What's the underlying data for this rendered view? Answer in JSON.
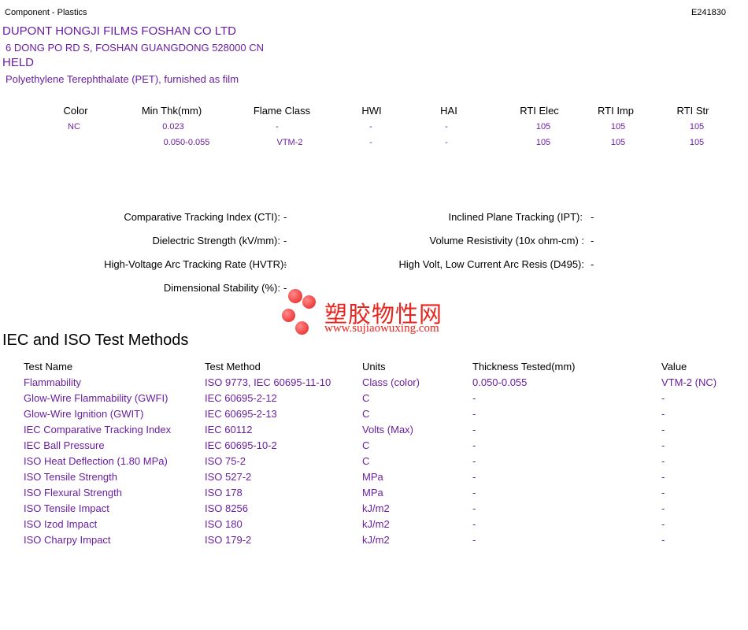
{
  "header": {
    "left_label": "Component - Plastics",
    "file_number": "E241830"
  },
  "company": {
    "name": "DUPONT HONGJI FILMS FOSHAN CO LTD",
    "address": "6 DONG PO RD S, FOSHAN  GUANGDONG  528000 CN",
    "product": "HELD",
    "material": "Polyethylene Terephthalate (PET), furnished as film"
  },
  "ratings": {
    "headers": [
      "Color",
      "Min Thk(mm)",
      "Flame Class",
      "HWI",
      "HAI",
      "RTI Elec",
      "RTI Imp",
      "RTI Str"
    ],
    "rows": [
      [
        "NC",
        "0.023",
        "-",
        "-",
        "-",
        "105",
        "105",
        "105"
      ],
      [
        "",
        "0.050-0.055",
        "VTM-2",
        "-",
        "-",
        "105",
        "105",
        "105"
      ]
    ]
  },
  "properties": {
    "cti_label": "Comparative Tracking Index (CTI):",
    "cti_value": "-",
    "ipt_label": "Inclined Plane Tracking (IPT):",
    "ipt_value": "-",
    "dielectric_label": "Dielectric Strength (kV/mm):",
    "dielectric_value": "-",
    "volume_label": "Volume Resistivity (10x ohm-cm) :",
    "volume_value": "-",
    "hvtr_label": "High-Voltage Arc Tracking Rate (HVTR):",
    "hvtr_value": "-",
    "d495_label": "High Volt, Low Current Arc Resis (D495):",
    "d495_value": "-",
    "dimstab_label": "Dimensional Stability (%):",
    "dimstab_value": "-"
  },
  "watermark": {
    "chinese": "塑胶物性网",
    "url": "www.sujiaowuxing.com",
    "color": "#e8261f"
  },
  "methods": {
    "section_title": "IEC and ISO Test Methods",
    "headers": [
      "Test Name",
      "Test Method",
      "Units",
      "Thickness Tested(mm)",
      "Value"
    ],
    "rows": [
      [
        "Flammability",
        "ISO 9773, IEC 60695-11-10",
        "Class (color)",
        "0.050-0.055",
        "VTM-2 (NC)"
      ],
      [
        "Glow-Wire Flammability (GWFI)",
        "IEC 60695-2-12",
        "C",
        "-",
        "-"
      ],
      [
        "Glow-Wire Ignition (GWIT)",
        "IEC 60695-2-13",
        "C",
        "-",
        "-"
      ],
      [
        "IEC Comparative Tracking Index",
        "IEC 60112",
        "Volts (Max)",
        "-",
        "-"
      ],
      [
        "IEC Ball Pressure",
        "IEC 60695-10-2",
        "C",
        "-",
        "-"
      ],
      [
        "ISO Heat Deflection (1.80 MPa)",
        "ISO 75-2",
        "C",
        "-",
        "-"
      ],
      [
        "ISO Tensile Strength",
        "ISO 527-2",
        "MPa",
        "-",
        "-"
      ],
      [
        "ISO Flexural Strength",
        "ISO 178",
        "MPa",
        "-",
        "-"
      ],
      [
        "ISO Tensile Impact",
        "ISO 8256",
        "kJ/m2",
        "-",
        "-"
      ],
      [
        "ISO Izod Impact",
        "ISO 180",
        "kJ/m2",
        "-",
        "-"
      ],
      [
        "ISO Charpy Impact",
        "ISO 179-2",
        "kJ/m2",
        "-",
        "-"
      ]
    ]
  },
  "colors": {
    "text": "#000000",
    "accent": "#6a1fa0",
    "watermark": "#e8261f"
  }
}
